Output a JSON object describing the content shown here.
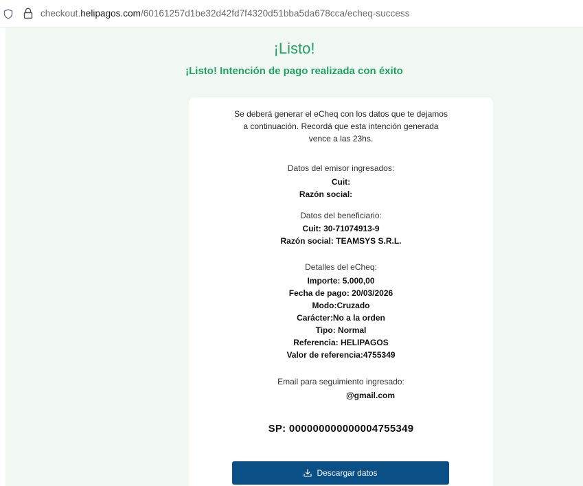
{
  "browser": {
    "url_prefix": "checkout.",
    "url_domain": "helipagos.com",
    "url_path": "/60161257d1be32d42fd7f4320d51bba5da678cca/echeq-success"
  },
  "page": {
    "title": "¡Listo!",
    "subtitle": "¡Listo! Intención de pago realizada con éxito"
  },
  "intro": {
    "line1": "Se deberá generar el eCheq con los datos que te dejamos",
    "line2": "a continuación. Recordá que esta intención generada",
    "line3": "vence a las 23hs."
  },
  "emisor": {
    "label": "Datos del emisor ingresados:",
    "cuit": "Cuit:",
    "razon_social": "Razón social:"
  },
  "beneficiario": {
    "label": "Datos del beneficiario:",
    "cuit": "Cuit: 30-71074913-9",
    "razon_social": "Razón social: TEAMSYS S.R.L."
  },
  "echeq": {
    "label": "Detalles del eCheq:",
    "importe": "Importe: 5.000,00",
    "fecha_pago": "Fecha de pago: 20/03/2026",
    "modo": "Modo:Cruzado",
    "caracter": "Carácter:No a la orden",
    "tipo": "Tipo: Normal",
    "referencia": "Referencia: HELIPAGOS",
    "valor_referencia": "Valor de referencia:4755349"
  },
  "email": {
    "label": "Email para seguimiento ingresado:",
    "value": "@gmail.com"
  },
  "sp": "SP: 000000000000004755349",
  "download_button": {
    "label": "Descargar datos"
  },
  "colors": {
    "accent_green": "#21a163",
    "button_blue": "#0a4f86",
    "page_background": "#f1f8f3"
  }
}
